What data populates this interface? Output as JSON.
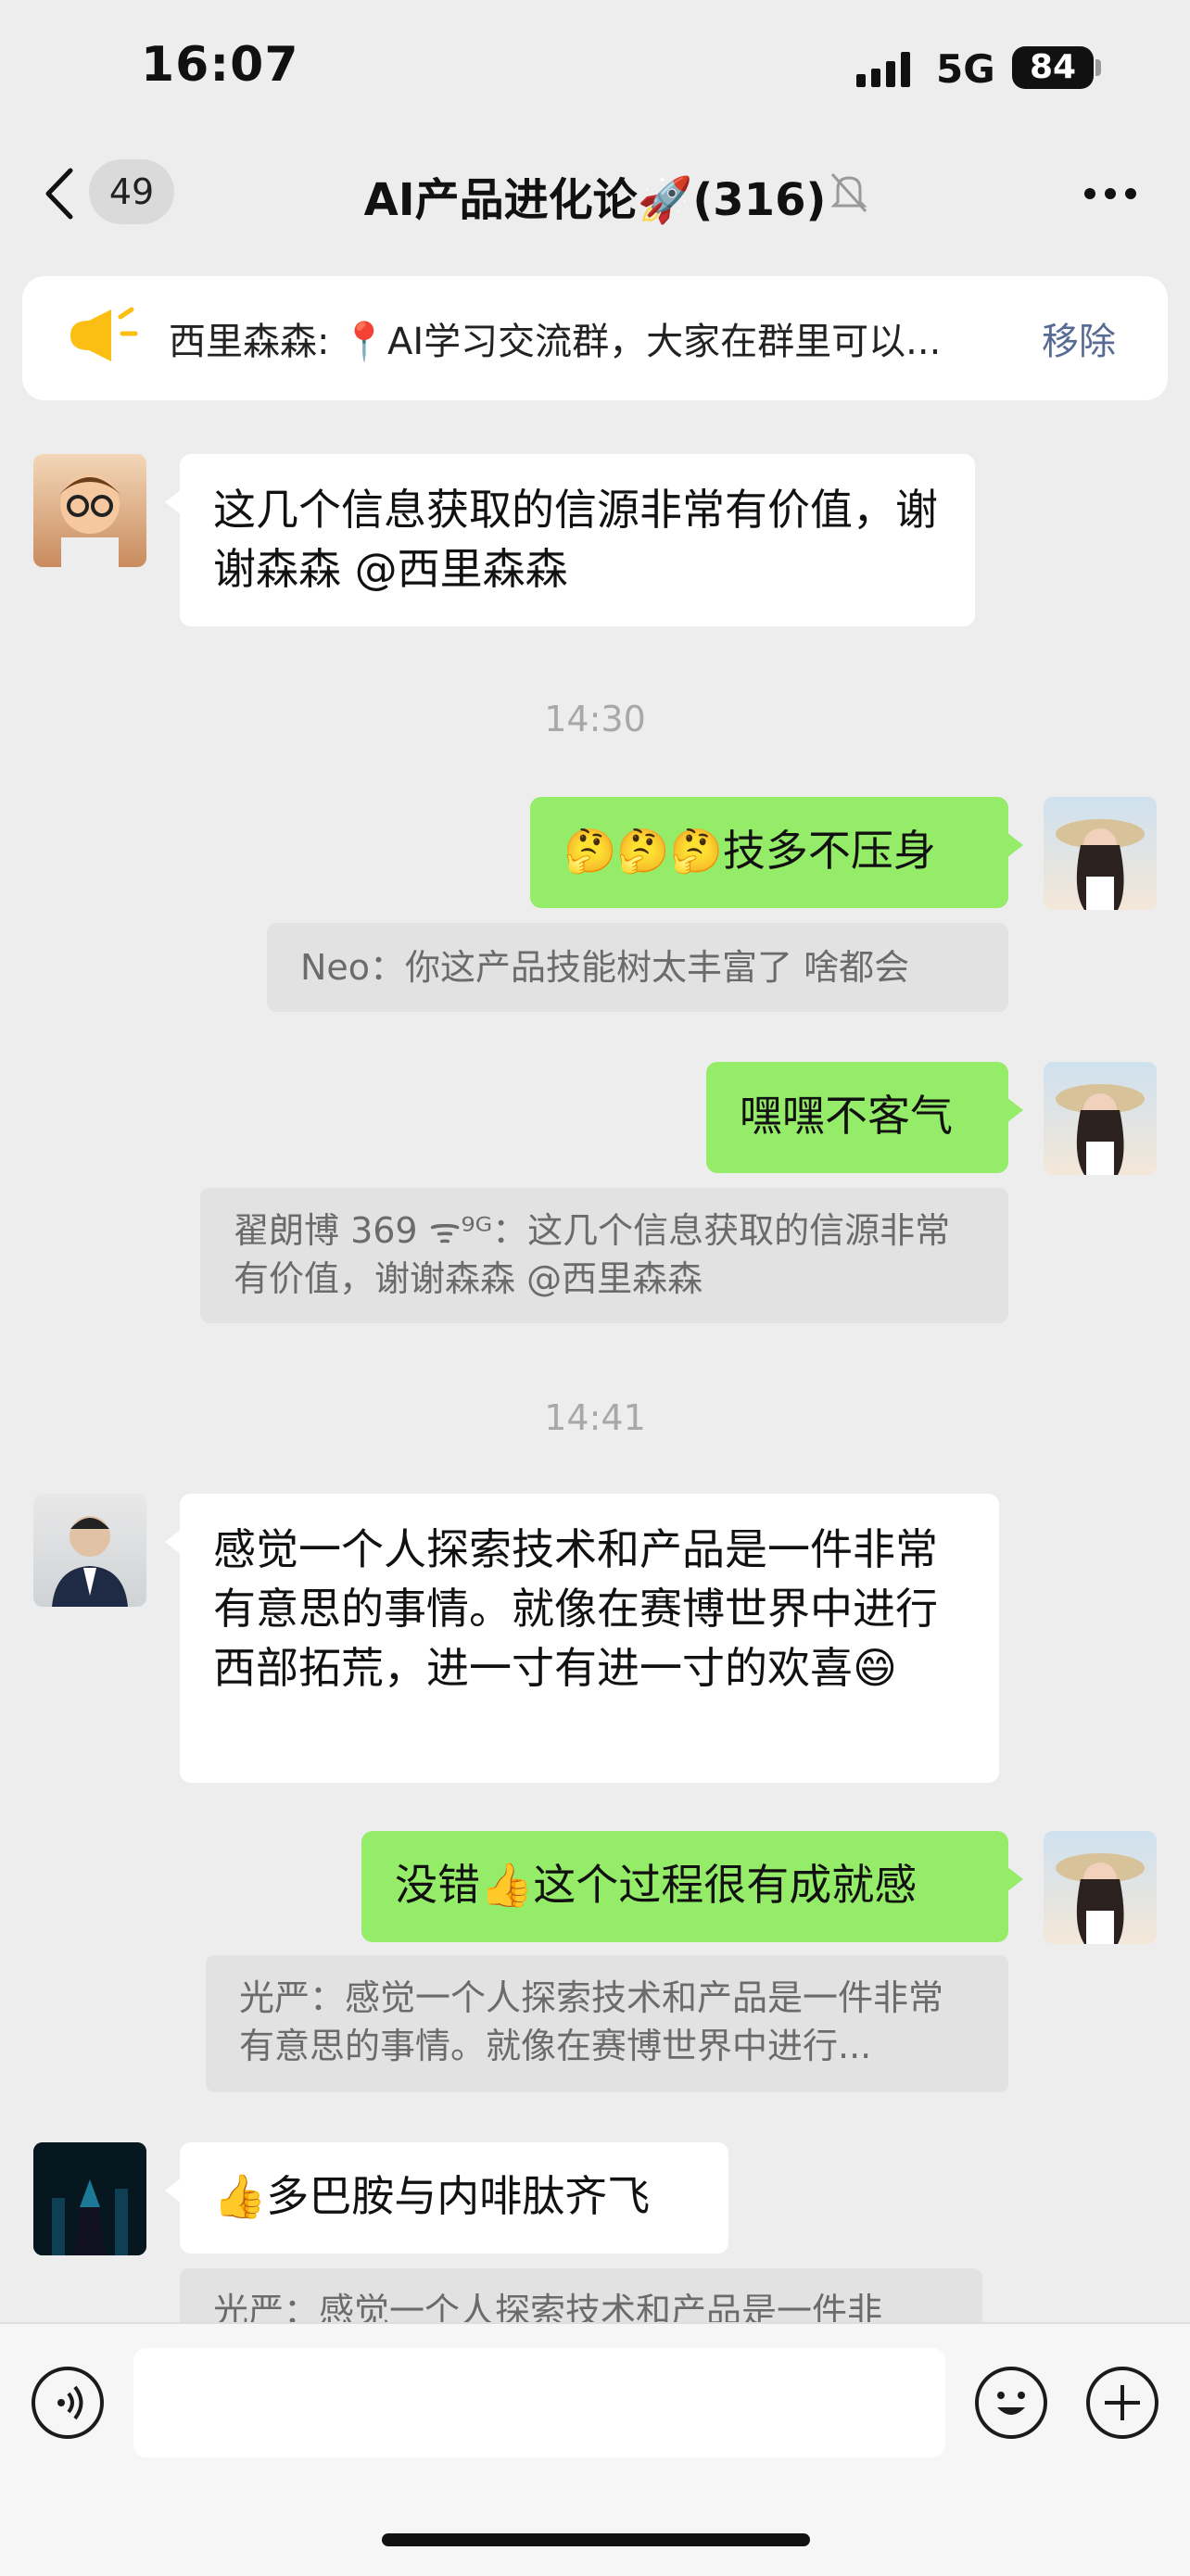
{
  "status_bar": {
    "time": "16:07",
    "network": "5G",
    "battery": "84"
  },
  "nav": {
    "unread_count": "49",
    "title": "AI产品进化论🚀(316)"
  },
  "pinned": {
    "text": "西里森森: 📍AI学习交流群，大家在群里可以...",
    "remove_label": "移除"
  },
  "messages": [
    {
      "side": "left",
      "text": "这几个信息获取的信源非常有价值，谢谢森森 @西里森森"
    },
    {
      "timestamp": "14:30"
    },
    {
      "side": "right",
      "text": "🤔🤔🤔技多不压身",
      "quote": "Neo：你这产品技能树太丰富了  啥都会"
    },
    {
      "side": "right",
      "text": "嘿嘿不客气",
      "quote": "翟朗博 369 ᯤ⁹ᴳ：这几个信息获取的信源非常有价值，谢谢森森 @西里森森"
    },
    {
      "timestamp": "14:41"
    },
    {
      "side": "left",
      "text": "感觉一个人探索技术和产品是一件非常有意思的事情。就像在赛博世界中进行西部拓荒，进一寸有进一寸的欢喜😄"
    },
    {
      "side": "right",
      "text": "没错👍这个过程很有成就感",
      "quote": "光严：感觉一个人探索技术和产品是一件非常有意思的事情。就像在赛博世界中进行..."
    },
    {
      "side": "left",
      "text": "👍多巴胺与内啡肽齐飞",
      "quote": "光严：感觉一个人探索技术和产品是一件非"
    }
  ],
  "icons": {
    "back": "chevron-left-icon",
    "mute": "bell-off-icon",
    "more": "more-dots-icon",
    "voice": "voice-icon",
    "emoji": "emoji-icon",
    "add": "plus-icon",
    "pin": "horn-icon"
  },
  "colors": {
    "background": "#ededed",
    "self_bubble": "#95ec69",
    "other_bubble": "#ffffff",
    "link": "#576b95"
  }
}
